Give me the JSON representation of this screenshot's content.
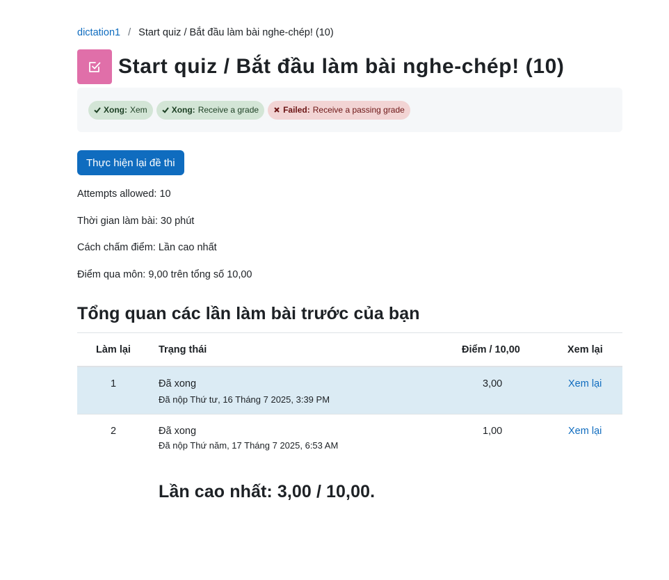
{
  "breadcrumb": {
    "parent": "dictation1",
    "current": "Start quiz / Bắt đầu làm bài nghe-chép! (10)"
  },
  "page_title": "Start quiz / Bắt đầu làm bài nghe-chép! (10)",
  "module_icon": "quiz-check-icon",
  "completion": [
    {
      "status": "Xong:",
      "text": "Xem",
      "state": "done"
    },
    {
      "status": "Xong:",
      "text": "Receive a grade",
      "state": "done"
    },
    {
      "status": "Failed:",
      "text": "Receive a passing grade",
      "state": "failed"
    }
  ],
  "reattempt_button": "Thực hiện lại đề thi",
  "info": {
    "attempts_allowed": "Attempts allowed: 10",
    "time_limit": "Thời gian làm bài: 30 phút",
    "grading_method": "Cách chấm điểm: Lần cao nhất",
    "passing_grade": "Điểm qua môn: 9,00 trên tổng số 10,00"
  },
  "summary_heading": "Tổng quan các lần làm bài trước của bạn",
  "table": {
    "headers": {
      "attempt": "Làm lại",
      "status": "Trạng thái",
      "grade": "Điểm / 10,00",
      "review": "Xem lại"
    },
    "rows": [
      {
        "attempt": "1",
        "status": "Đã xong",
        "submitted": "Đã nộp Thứ tư, 16 Tháng 7 2025, 3:39 PM",
        "grade": "3,00",
        "review": "Xem lại"
      },
      {
        "attempt": "2",
        "status": "Đã xong",
        "submitted": "Đã nộp Thứ năm, 17 Tháng 7 2025, 6:53 AM",
        "grade": "1,00",
        "review": "Xem lại"
      }
    ]
  },
  "highest_grade": "Lần cao nhất: 3,00 / 10,00.",
  "colors": {
    "accent": "#0f6cbf",
    "module_icon_bg": "#e06fa9",
    "done_badge": "#d3e5d6",
    "failed_badge": "#f2d4d4",
    "row_highlight": "#dbebf4"
  }
}
